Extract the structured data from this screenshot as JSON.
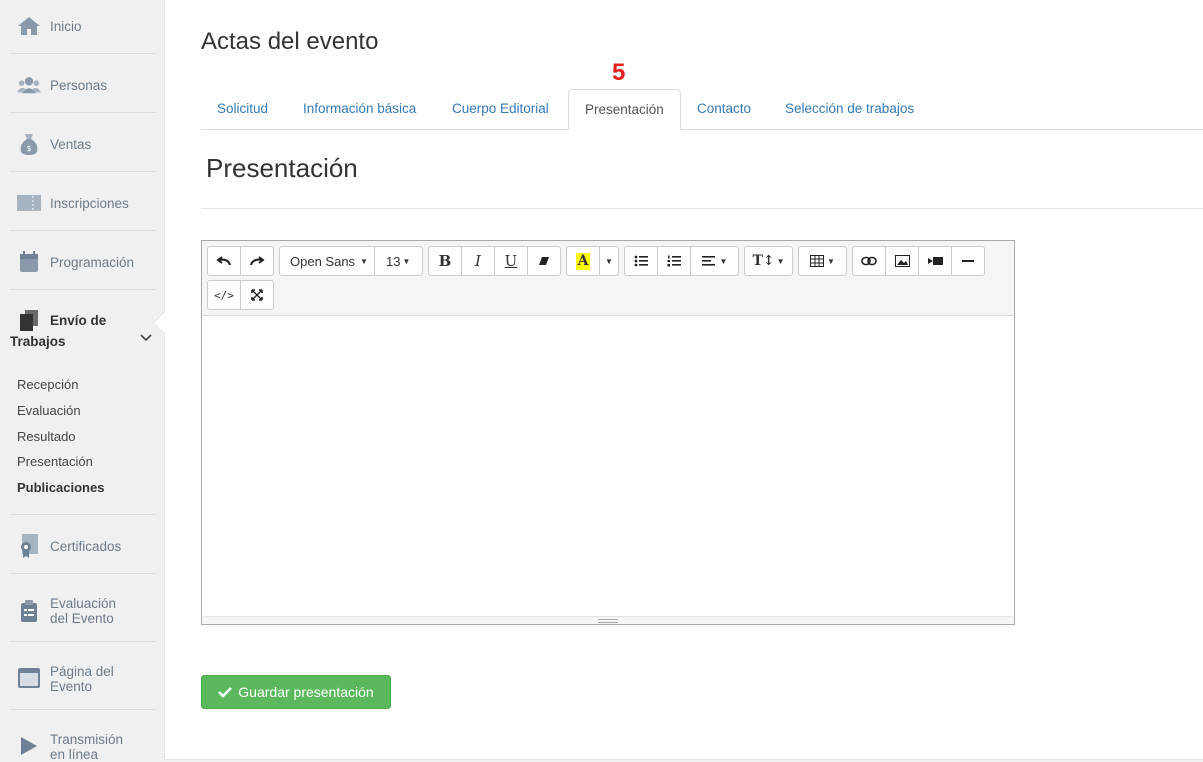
{
  "sidebar": {
    "items": [
      {
        "label": "Inicio",
        "icon": "home-icon"
      },
      {
        "label": "Personas",
        "icon": "users-icon"
      },
      {
        "label": "Ventas",
        "icon": "money-bag-icon"
      },
      {
        "label": "Inscripciones",
        "icon": "ticket-icon"
      },
      {
        "label": "Programación",
        "icon": "calendar-icon"
      }
    ],
    "envio": {
      "label_line1": "Envío de",
      "label_line2": "Trabajos",
      "icon": "documents-icon"
    },
    "subitems": [
      "Recepción",
      "Evaluación",
      "Resultado",
      "Presentación",
      "Publicaciones"
    ],
    "active_subitem": "Publicaciones",
    "bottom_items": [
      {
        "label": "Certificados",
        "icon": "certificate-icon"
      },
      {
        "label_line1": "Evaluación",
        "label_line2": "del Evento",
        "icon": "clipboard-icon"
      },
      {
        "label_line1": "Página del",
        "label_line2": "Evento",
        "icon": "webpage-icon"
      },
      {
        "label_line1": "Transmisión",
        "label_line2": "en línea",
        "icon": "play-icon"
      }
    ]
  },
  "main": {
    "title": "Actas del evento",
    "step_marker": "5",
    "tabs": [
      "Solicitud",
      "Información básica",
      "Cuerpo Editorial",
      "Presentación",
      "Contacto",
      "Selección de trabajos"
    ],
    "active_tab": "Presentación",
    "section_title": "Presentación",
    "editor": {
      "font_family": "Open Sans",
      "font_size": "13",
      "content": ""
    },
    "save_label": "Guardar presentación"
  },
  "colors": {
    "link": "#337ab7",
    "save_button": "#5cb85c",
    "step_marker": "#e0201b",
    "highlight": "#ffff00"
  }
}
